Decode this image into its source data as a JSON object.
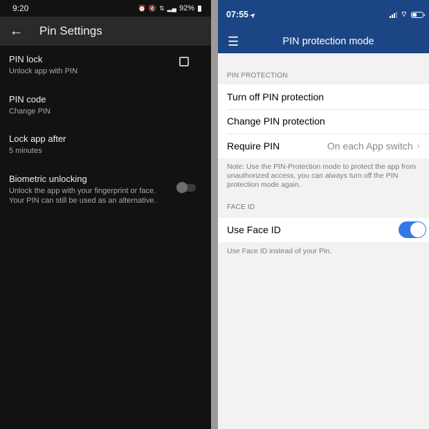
{
  "android": {
    "status_bar": {
      "time": "9:20",
      "icons": [
        "alarm-icon",
        "mute-icon",
        "4g-icon",
        "signal-icon"
      ],
      "battery": "92%"
    },
    "app_bar": {
      "title": "Pin Settings",
      "back_icon": "arrow-left-icon"
    },
    "items": [
      {
        "title": "PIN lock",
        "subtitle": "Unlock app with PIN",
        "control": "checkbox",
        "checked": false
      },
      {
        "title": "PIN code",
        "subtitle": "Change PIN"
      },
      {
        "title": "Lock app after",
        "subtitle": "5 minutes"
      },
      {
        "title": "Biometric unlocking",
        "subtitle_line1": "Unlock the app with your fingerprint or face.",
        "subtitle_line2": "Your PIN can still be used as an alternative.",
        "control": "switch",
        "on": false
      }
    ]
  },
  "ios": {
    "status_bar": {
      "time": "07:55",
      "location_icon": "➤"
    },
    "nav": {
      "title": "PIN protection mode",
      "menu_icon": "☰"
    },
    "section_pin": {
      "header": "PIN PROTECTION",
      "rows": [
        {
          "label": "Turn off PIN protection"
        },
        {
          "label": "Change PIN protection"
        },
        {
          "label": "Require PIN",
          "value": "On each App switch",
          "chevron": "›"
        }
      ],
      "note": "Note: Use the PIN-Protection mode to protect the app from unauthorized access, you can always turn off the PIN protection mode again."
    },
    "section_face": {
      "header": "FACE ID",
      "row": {
        "label": "Use Face ID",
        "on": true
      },
      "footer": "Use Face ID instead of your Pin."
    },
    "colors": {
      "header": "#1b4585",
      "toggle_on": "#3478e5"
    }
  }
}
